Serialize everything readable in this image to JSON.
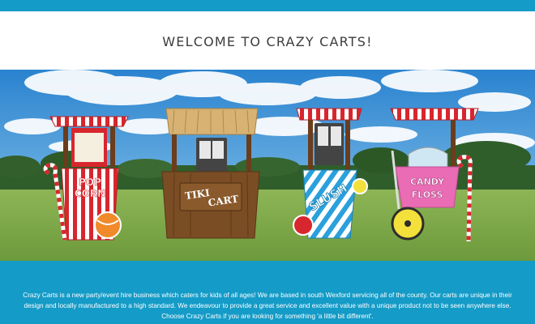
{
  "page": {
    "title": "WELCOME TO CRAZY CARTS!",
    "intro": "Crazy Carts is a new party/event hire business which caters for kids of all ages! We are based in south Wexford servicing all of the county. Our carts are unique in their design and locally manufactured to a high standard. We endeavour to provide a great service and excellent value with a unique product not to be seen anywhere else. Choose Crazy Carts if you are looking for something 'a little bit different'."
  },
  "hero": {
    "carts": [
      {
        "name": "popcorn-cart",
        "sign": [
          "POP",
          "CORN"
        ]
      },
      {
        "name": "tiki-cart",
        "sign": [
          "TIKI",
          "CART"
        ]
      },
      {
        "name": "slush-cart",
        "sign": [
          "SLUSH"
        ]
      },
      {
        "name": "candy-floss-cart",
        "sign": [
          "CANDY",
          "FLOSS"
        ]
      }
    ]
  },
  "colors": {
    "band": "#149bc7",
    "title": "#3d3d3d",
    "sky": "#2f8fd4",
    "grass": "#7fa84a",
    "candy_red": "#d8262e",
    "wood": "#7a4d25",
    "slush_blue": "#2aa0dc",
    "floss_pink": "#e96cb4"
  }
}
